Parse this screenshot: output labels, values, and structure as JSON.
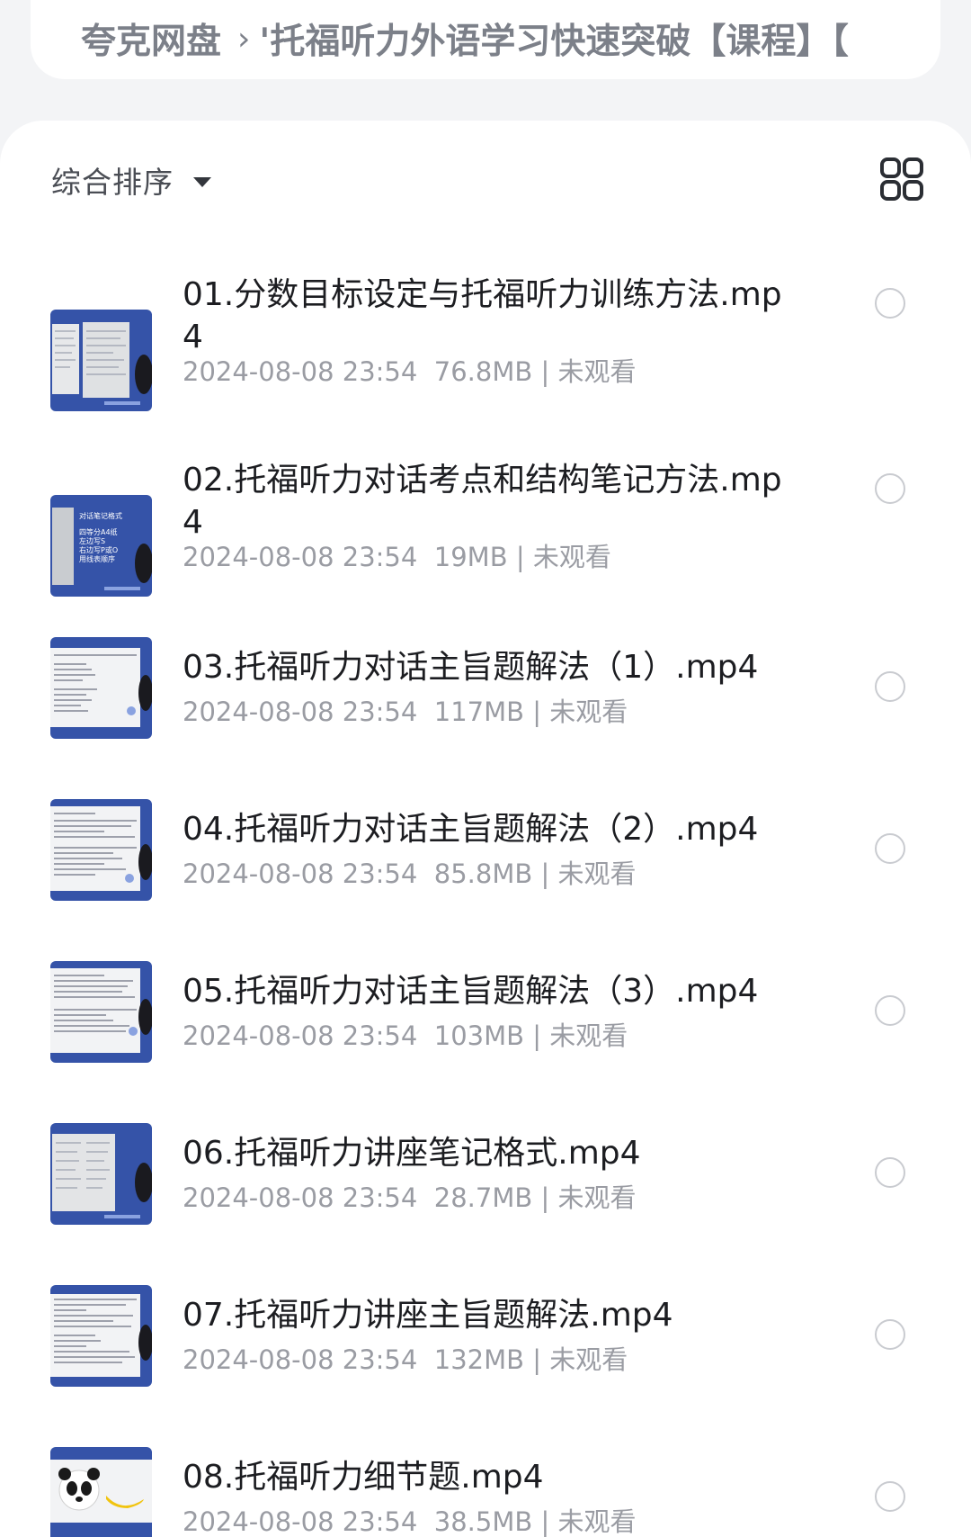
{
  "breadcrumb": {
    "root": "夸克网盘",
    "separator": "›",
    "current": "'托福听力外语学习快速突破【课程】【"
  },
  "toolbar": {
    "sort_label": "综合排序",
    "caret_icon": "caret-down-icon",
    "view_icon": "grid-view-icon"
  },
  "files": [
    {
      "name": "01.分数目标设定与托福听力训练方法.mp4",
      "date": "2024-08-08 23:54",
      "size": "76.8MB",
      "status": "未观看"
    },
    {
      "name": "02.托福听力对话考点和结构笔记方法.mp4",
      "date": "2024-08-08 23:54",
      "size": "19MB",
      "status": "未观看"
    },
    {
      "name": "03.托福听力对话主旨题解法（1）.mp4",
      "date": "2024-08-08 23:54",
      "size": "117MB",
      "status": "未观看"
    },
    {
      "name": "04.托福听力对话主旨题解法（2）.mp4",
      "date": "2024-08-08 23:54",
      "size": "85.8MB",
      "status": "未观看"
    },
    {
      "name": "05.托福听力对话主旨题解法（3）.mp4",
      "date": "2024-08-08 23:54",
      "size": "103MB",
      "status": "未观看"
    },
    {
      "name": "06.托福听力讲座笔记格式.mp4",
      "date": "2024-08-08 23:54",
      "size": "28.7MB",
      "status": "未观看"
    },
    {
      "name": "07.托福听力讲座主旨题解法.mp4",
      "date": "2024-08-08 23:54",
      "size": "132MB",
      "status": "未观看"
    },
    {
      "name": "08.托福听力细节题.mp4",
      "date": "2024-08-08 23:54",
      "size": "38.5MB",
      "status": "未观看"
    }
  ],
  "meta_separator": "|",
  "thumb_text_02": [
    "对话笔记格式",
    "四等分A4纸",
    "左边写S",
    "右边写P或O",
    "用线表顺序"
  ],
  "colors": {
    "thumb_blue": "#3553a8",
    "text_primary": "#1c1d21",
    "text_secondary": "#9a9ca3",
    "background": "#f3f4f6"
  }
}
